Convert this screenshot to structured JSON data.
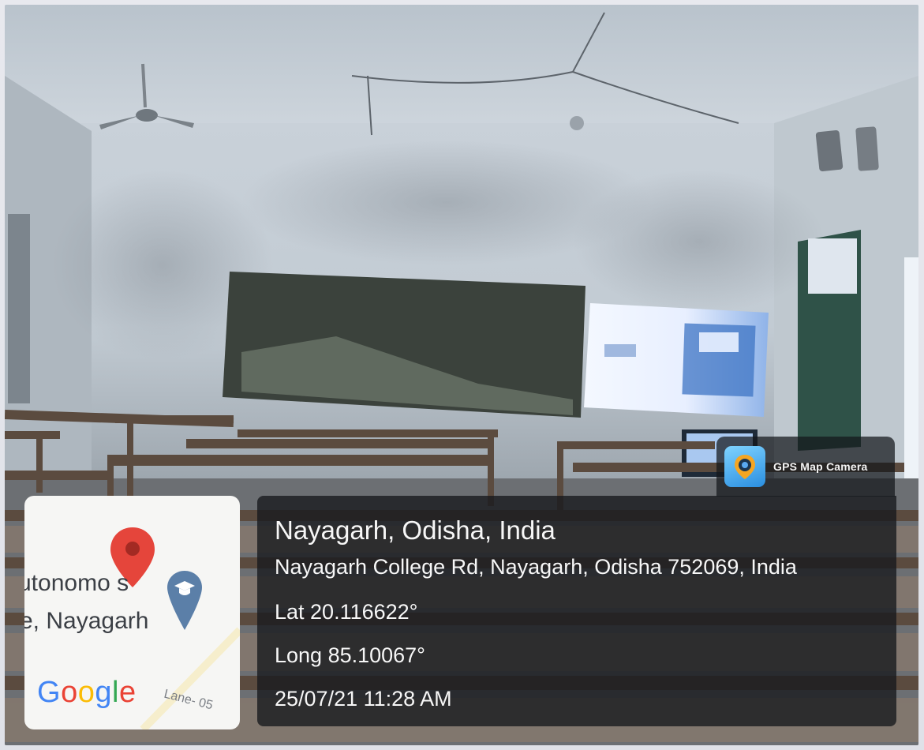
{
  "overlay": {
    "app_badge": "GPS Map Camera",
    "place_title": "Nayagarh, Odisha, India",
    "address": "Nayagarh College Rd, Nayagarh, Odisha 752069, India",
    "latitude": "Lat 20.116622°",
    "longitude": "Long 85.10067°",
    "datetime": "25/07/21 11:28 AM"
  },
  "minimap": {
    "label_line1": "utonomo  s",
    "label_line2": "e, Nayagarh",
    "road_label": "Lane- 05",
    "logo": [
      "G",
      "o",
      "o",
      "g",
      "l",
      "e"
    ],
    "logo_colors": [
      "#4285F4",
      "#EA4335",
      "#FBBC05",
      "#4285F4",
      "#34A853",
      "#EA4335"
    ],
    "pin_color": "#e5453b",
    "school_pin_color": "#5b7fa8",
    "pin_icon": "map-pin-icon",
    "school_icon": "graduation-cap-icon"
  },
  "badge": {
    "icon": "map-camera-icon"
  }
}
